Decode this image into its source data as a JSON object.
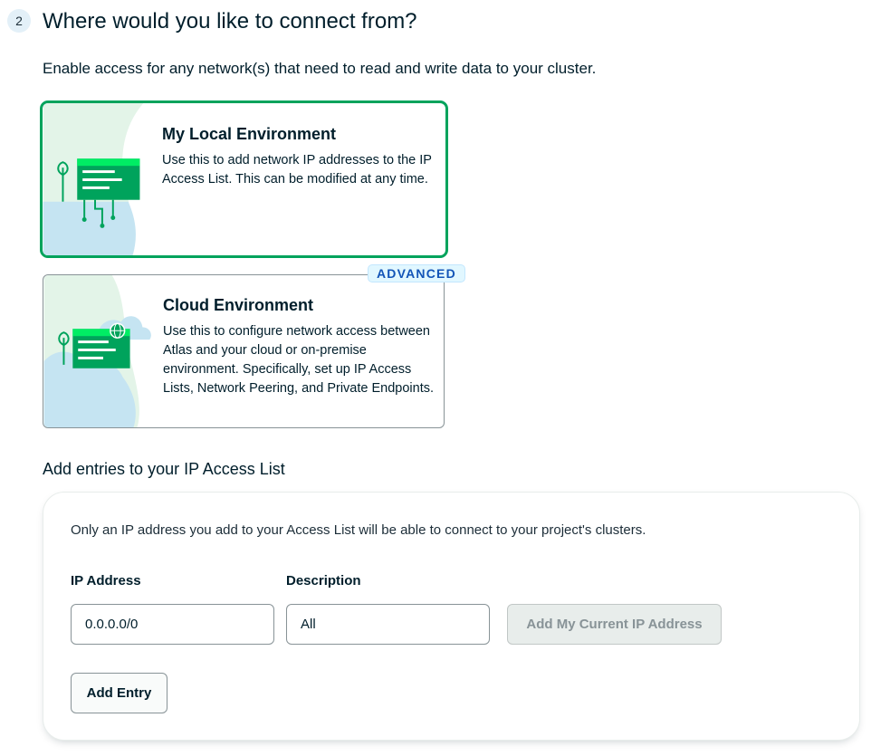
{
  "section": {
    "step_number": "2",
    "title": "Where would you like to connect from?",
    "subtitle": "Enable access for any network(s) that need to read and write data to your cluster."
  },
  "environments": [
    {
      "title": "My Local Environment",
      "description": "Use this to add network IP addresses to the IP Access List. This can be modified at any time.",
      "selected": true
    },
    {
      "title": "Cloud Environment",
      "badge": "ADVANCED",
      "description": "Use this to configure network access between Atlas and your cloud or on-premise environment. Specifically, set up IP Access Lists, Network Peering, and Private Endpoints.",
      "selected": false
    }
  ],
  "access_list": {
    "heading": "Add entries to your IP Access List",
    "note": "Only an IP address you add to your Access List will be able to connect to your project's clusters.",
    "ip_label": "IP Address",
    "ip_value": "0.0.0.0/0",
    "description_label": "Description",
    "description_value": "All",
    "add_current_ip_label": "Add My Current IP Address",
    "add_entry_label": "Add Entry"
  },
  "colors": {
    "selected_border": "#00a35c",
    "illustration_green": "#00a35c",
    "badge_text": "#1254b7",
    "badge_bg": "#e1f7ff"
  }
}
